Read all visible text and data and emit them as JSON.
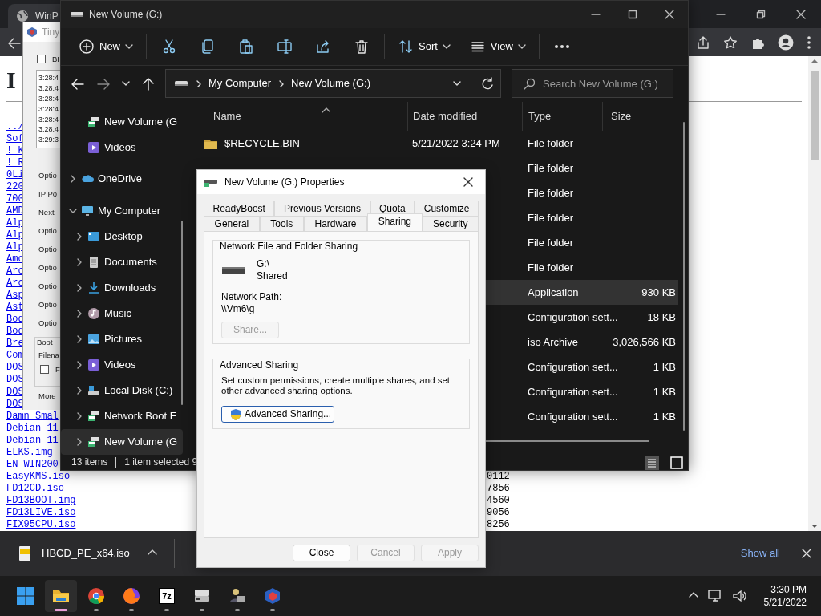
{
  "browser": {
    "tab_title": "WinP",
    "heading": "I",
    "links": [
      {
        "text": "../"
      },
      {
        "text": "Sof"
      },
      {
        "text": "! K"
      },
      {
        "text": "! R"
      },
      {
        "text": "0Li"
      },
      {
        "text": "220"
      },
      {
        "text": "700"
      },
      {
        "text": "AMD"
      },
      {
        "text": "Alp"
      },
      {
        "text": "Alp"
      },
      {
        "text": "Alp"
      },
      {
        "text": "Amo"
      },
      {
        "text": "Arc"
      },
      {
        "text": "Arc"
      },
      {
        "text": "Asp"
      },
      {
        "text": "Ast"
      },
      {
        "text": "Bod"
      },
      {
        "text": "Bod"
      },
      {
        "text": "Bre"
      },
      {
        "text": "Com"
      },
      {
        "text": "DOS"
      },
      {
        "text": "DOS"
      },
      {
        "text": "DOS"
      },
      {
        "text": "DOS"
      },
      {
        "text": "Damn Smal"
      },
      {
        "text": "Debian 11"
      },
      {
        "text": "Debian 11"
      },
      {
        "text": "ELKS.img"
      },
      {
        "text": "EN_WIN200"
      },
      {
        "text": "EasyKMS.iso",
        "size": "0112"
      },
      {
        "text": "FD12CD.iso",
        "size": "7856"
      },
      {
        "text": "FD13BOOT.img",
        "size": "4560"
      },
      {
        "text": "FD13LIVE.iso",
        "size": "9056"
      },
      {
        "text": "FIX95CPU.iso",
        "size": "8256"
      }
    ]
  },
  "tiny_window": {
    "title": "Tiny",
    "top_checkbox": {
      "label": "BI",
      "checked": false
    },
    "log": [
      "3:28:4",
      "3:28:4",
      "3:28:4",
      "3:28:4",
      "3:28:4",
      "3:28:4",
      "3:29:3"
    ],
    "fields": [
      "Optio",
      "IP Po",
      "Next-",
      "Optio",
      "Optio",
      "Optio",
      "Optio",
      "Optio",
      "Optio"
    ],
    "group_title": "Boot",
    "group_field": "Filena",
    "group_checkbox": {
      "label": "F",
      "checked": false
    },
    "more": "More"
  },
  "explorer": {
    "title": "New Volume (G:)",
    "toolbar": {
      "new": "New",
      "sort": "Sort",
      "view": "View"
    },
    "address": [
      "My Computer",
      "New Volume (G:)"
    ],
    "search_placeholder": "Search New Volume (G:)",
    "quick_items": [
      {
        "label": "New Volume (G",
        "selected": false
      },
      {
        "label": "Videos",
        "selected": false
      }
    ],
    "tree": [
      {
        "label": "OneDrive",
        "expanded": false,
        "selected": false
      },
      {
        "label": "My Computer",
        "expanded": true,
        "selected": false,
        "children": [
          {
            "label": "Desktop",
            "expanded": false,
            "selected": false
          },
          {
            "label": "Documents",
            "expanded": false,
            "selected": false
          },
          {
            "label": "Downloads",
            "expanded": false,
            "selected": false
          },
          {
            "label": "Music",
            "expanded": false,
            "selected": false
          },
          {
            "label": "Pictures",
            "expanded": false,
            "selected": false
          },
          {
            "label": "Videos",
            "expanded": false,
            "selected": false
          },
          {
            "label": "Local Disk (C:)",
            "expanded": false,
            "selected": false
          },
          {
            "label": "Network Boot F",
            "expanded": false,
            "selected": false
          },
          {
            "label": "New Volume (G",
            "expanded": false,
            "selected": true
          }
        ]
      }
    ],
    "columns": [
      "Name",
      "Date modified",
      "Type",
      "Size"
    ],
    "rows": [
      {
        "name": "$RECYCLE.BIN",
        "date": "5/21/2022 3:24 PM",
        "type": "File folder",
        "selected": false
      },
      {
        "type": "File folder",
        "selected": false
      },
      {
        "type": "File folder",
        "selected": false
      },
      {
        "type": "File folder",
        "selected": false
      },
      {
        "type": "File folder",
        "selected": false
      },
      {
        "type": "File folder",
        "selected": false
      },
      {
        "type": "Application",
        "size": "930 KB",
        "selected": true
      },
      {
        "type": "Configuration sett...",
        "size": "18 KB",
        "selected": false
      },
      {
        "type": "iso Archive",
        "size": "3,026,566 KB",
        "selected": false
      },
      {
        "type": "Configuration sett...",
        "size": "1 KB",
        "selected": false
      },
      {
        "type": "Configuration sett...",
        "size": "1 KB",
        "selected": false
      },
      {
        "type": "Configuration sett...",
        "size": "1 KB",
        "selected": false
      }
    ],
    "status": {
      "count": "13 items",
      "selection": "1 item selected 9"
    }
  },
  "dialog": {
    "title": "New Volume (G:) Properties",
    "tab_rows": [
      {
        "tabs": [
          {
            "label": "ReadyBoost",
            "selected": false
          },
          {
            "label": "Previous Versions",
            "selected": false
          },
          {
            "label": "Quota",
            "selected": false
          },
          {
            "label": "Customize",
            "selected": false
          }
        ]
      },
      {
        "tabs": [
          {
            "label": "General",
            "selected": false
          },
          {
            "label": "Tools",
            "selected": false
          },
          {
            "label": "Hardware",
            "selected": false
          },
          {
            "label": "Sharing",
            "selected": true
          },
          {
            "label": "Security",
            "selected": false
          }
        ]
      }
    ],
    "sharing_group": {
      "title": "Network File and Folder Sharing",
      "drive": "G:\\",
      "status": "Shared",
      "path_label": "Network Path:",
      "path": "\\\\Vm6\\g",
      "share_button": {
        "label": "Share...",
        "disabled": true
      }
    },
    "advanced_group": {
      "title": "Advanced Sharing",
      "description": "Set custom permissions, create multiple shares, and set other advanced sharing options.",
      "button": {
        "label": "Advanced Sharing...",
        "disabled": false
      }
    },
    "buttons": [
      {
        "label": "Close",
        "disabled": false
      },
      {
        "label": "Cancel",
        "disabled": true
      },
      {
        "label": "Apply",
        "disabled": true
      }
    ]
  },
  "download_bar": {
    "file": "HBCD_PE_x64.iso",
    "show_all": "Show all"
  },
  "taskbar": {
    "apps": [
      {
        "active": true
      },
      {
        "active": false
      },
      {
        "active": false
      },
      {
        "active": false,
        "label": "7z"
      },
      {
        "active": false
      },
      {
        "active": false
      },
      {
        "active": false
      }
    ],
    "time": "3:30 PM",
    "date": "5/21/2022"
  }
}
